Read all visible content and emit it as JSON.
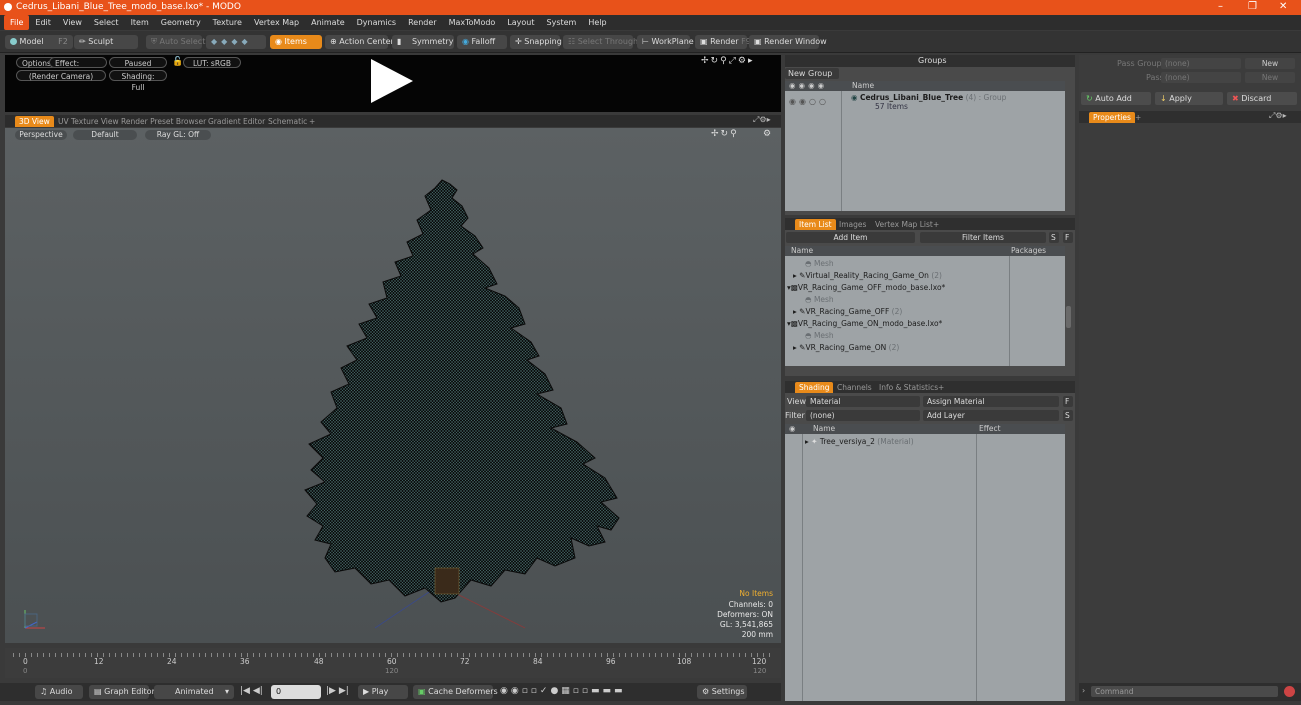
{
  "window": {
    "title": "Cedrus_Libani_Blue_Tree_modo_base.lxo* - MODO"
  },
  "menu": [
    "File",
    "Edit",
    "View",
    "Select",
    "Item",
    "Geometry",
    "Texture",
    "Vertex Map",
    "Animate",
    "Dynamics",
    "Render",
    "MaxToModo",
    "Layout",
    "System",
    "Help"
  ],
  "toolbar": {
    "model": "Model",
    "model_key": "F2",
    "sculpt": "Sculpt",
    "auto_select": "Auto Select",
    "items": "Items",
    "action_center": "Action Center",
    "symmetry": "Symmetry",
    "falloff": "Falloff",
    "snapping": "Snapping",
    "select_through": "Select Through",
    "workplane": "WorkPlane",
    "render": "Render",
    "render_key": "F9",
    "render_window": "Render Window"
  },
  "preview": {
    "options": "Options",
    "effect": "Effect: (Shadi...",
    "paused": "Paused",
    "lut": "LUT: sRGB",
    "camera": "(Render Camera)",
    "shading": "Shading: Full"
  },
  "viewport_tabs": [
    "3D View",
    "UV Texture View",
    "Render Preset Browser",
    "Gradient Editor",
    "Schematic",
    "+"
  ],
  "viewport": {
    "perspective": "Perspective",
    "default": "Default",
    "raygl": "Ray GL: Off",
    "stats": {
      "items": "No Items",
      "channels": "Channels: 0",
      "deformers": "Deformers: ON",
      "gl": "GL: 3,541,865",
      "scale": "200 mm"
    }
  },
  "timeline": {
    "ticks": [
      "0",
      "12",
      "24",
      "36",
      "48",
      "60",
      "72",
      "84",
      "96",
      "108",
      "120"
    ],
    "sub_left": "0",
    "sub_mid": "120",
    "sub_right": "120"
  },
  "bottombar": {
    "audio": "Audio",
    "graph_editor": "Graph Editor",
    "animated": "Animated",
    "frame": "0",
    "play": "Play",
    "cache": "Cache Deformers",
    "settings": "Settings"
  },
  "groups": {
    "title": "Groups",
    "new_group": "New Group",
    "col_name": "Name",
    "item_name": "Cedrus_Libani_Blue_Tree",
    "item_count": "(4)",
    "item_type": ": Group",
    "item_sub": "57 Items"
  },
  "itemlist": {
    "tabs": [
      "Item List",
      "Images",
      "Vertex Map List",
      "+"
    ],
    "add_item": "Add Item",
    "filter": "Filter Items",
    "s": "S",
    "f": "F",
    "col_name": "Name",
    "col_packages": "Packages",
    "rows": [
      {
        "label": "Mesh",
        "dim": true,
        "indent": 1
      },
      {
        "label": "Virtual_Reality_Racing_Game_On",
        "count": "(2)",
        "indent": 1
      },
      {
        "label": "VR_Racing_Game_OFF_modo_base.lxo*",
        "indent": 0
      },
      {
        "label": "Mesh",
        "dim": true,
        "indent": 1
      },
      {
        "label": "VR_Racing_Game_OFF",
        "count": "(2)",
        "indent": 1
      },
      {
        "label": "VR_Racing_Game_ON_modo_base.lxo*",
        "indent": 0
      },
      {
        "label": "Mesh",
        "dim": true,
        "indent": 1
      },
      {
        "label": "VR_Racing_Game_ON",
        "count": "(2)",
        "indent": 1
      }
    ]
  },
  "shading": {
    "tabs": [
      "Shading",
      "Channels",
      "Info & Statistics",
      "+"
    ],
    "view_label": "View",
    "view_value": "Material",
    "assign": "Assign Material",
    "filter_label": "Filter",
    "filter_value": "(none)",
    "add_layer": "Add Layer",
    "col_name": "Name",
    "col_effect": "Effect",
    "row_name": "Tree_versiya_2",
    "row_type": "(Material)"
  },
  "props": {
    "pass_groups": "Pass Groups",
    "passes": "Passes",
    "none": "(none)",
    "new": "New",
    "auto_add": "Auto Add",
    "apply": "Apply",
    "discard": "Discard",
    "tab": "Properties",
    "command": "Command"
  }
}
